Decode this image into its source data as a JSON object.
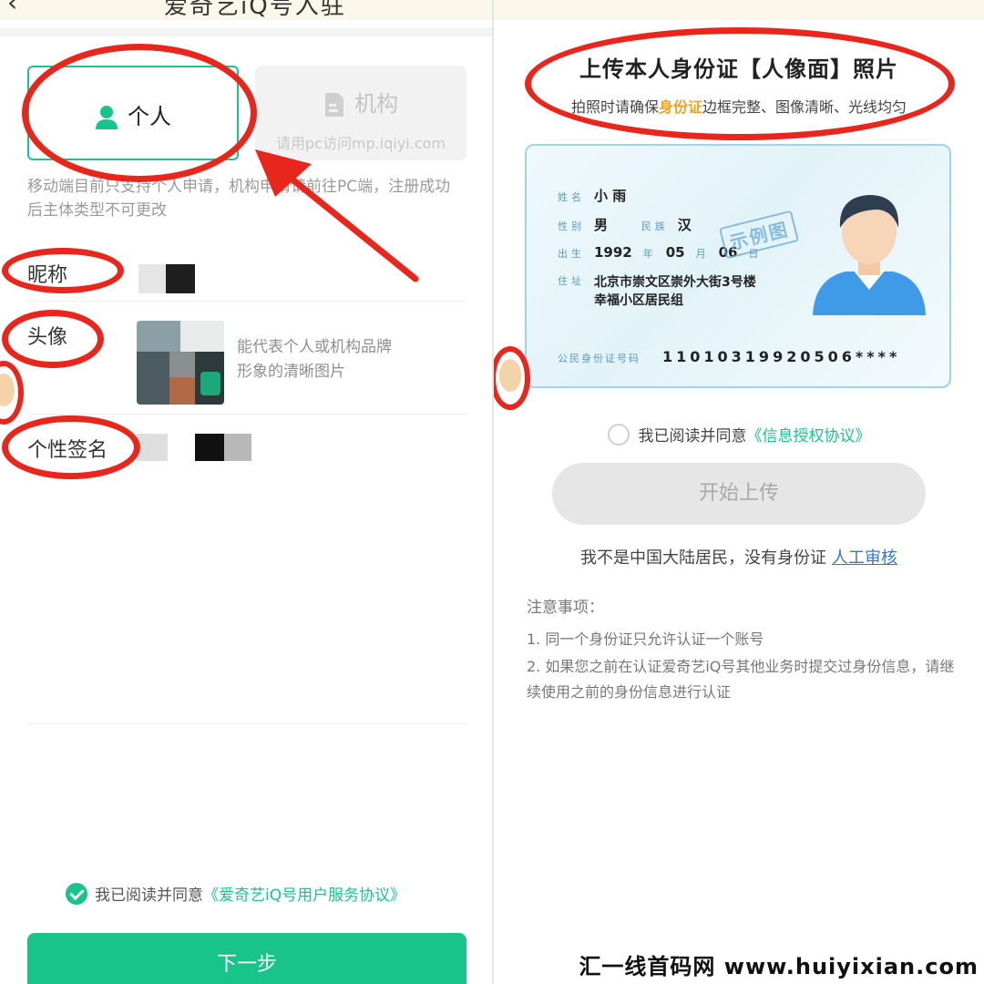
{
  "colors": {
    "accent": "#19c48a",
    "annotation_red": "#e8261c",
    "highlight_orange": "#f2a31b",
    "link_blue": "#3478c6"
  },
  "left": {
    "header": {
      "back_icon": "chevron-left-icon",
      "title": "爱奇艺iQ号入驻"
    },
    "account_type": {
      "personal": {
        "label": "个人",
        "icon": "user-icon"
      },
      "organization": {
        "label": "机构",
        "sub": "请用pc访问mp.iqiyi.com",
        "icon": "document-icon"
      }
    },
    "hint": "移动端目前只支持个人申请，机构申请请前往PC端，注册成功后主体类型不可更改",
    "fields": {
      "nickname": "昵称",
      "avatar": "头像",
      "avatar_hint_1": "能代表个人或机构品牌",
      "avatar_hint_2": "形象的清晰图片",
      "signature": "个性签名"
    },
    "agreement": {
      "prefix": "我已阅读并同意",
      "link": "《爱奇艺iQ号用户服务协议》"
    },
    "next_button": "下一步"
  },
  "right": {
    "title": "上传本人身份证【人像面】照片",
    "subtitle": {
      "before": "拍照时请确保",
      "highlight": "身份证",
      "after": "边框完整、图像清晰、光线均匀"
    },
    "id_card": {
      "name_key": "姓名",
      "name": "小 雨",
      "gender_key": "性别",
      "gender": "男",
      "ethnicity_key": "民族",
      "ethnicity": "汉",
      "birth_key": "出生",
      "year": "1992",
      "year_unit": "年",
      "month": "05",
      "month_unit": "月",
      "day": "06",
      "day_unit": "日",
      "address_key": "住址",
      "address_1": "北京市崇文区崇外大街3号楼",
      "address_2": "幸福小区居民组",
      "id_key": "公民身份证号码",
      "id_number": "11010319920506****",
      "stamp": "示例图"
    },
    "agreement": {
      "prefix": "我已阅读并同意",
      "link": "《信息授权协议》"
    },
    "upload_button": "开始上传",
    "not_resident": {
      "text": "我不是中国大陆居民，没有身份证",
      "link": "人工审核"
    },
    "notes": {
      "heading": "注意事项：",
      "items": [
        "1. 同一个身份证只允许认证一个账号",
        "2. 如果您之前在认证爱奇艺iQ号其他业务时提交过身份信息，请继续使用之前的身份信息进行认证"
      ]
    }
  },
  "watermark": "汇一线首码网 www.huiyixian.com"
}
